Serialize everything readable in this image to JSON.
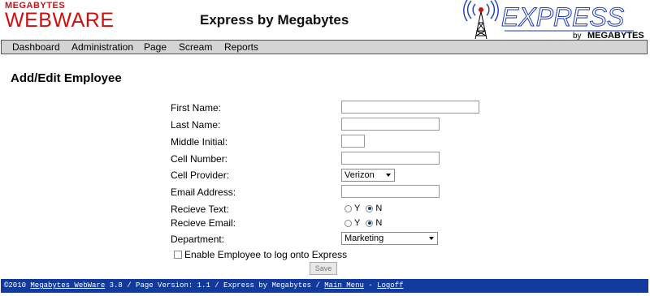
{
  "header": {
    "logo_top": "MEGABYTES",
    "logo_main": "WEBWARE",
    "title": "Express by Megabytes",
    "brand_word": "EXPRESS",
    "brand_by": "by",
    "brand_company": "MEGABYTES"
  },
  "nav": [
    "Dashboard",
    "Administration",
    "Page",
    "Scream",
    "Reports"
  ],
  "page_title": "Add/Edit Employee",
  "form": {
    "first_name_label": "First Name:",
    "first_name_value": "",
    "last_name_label": "Last Name:",
    "last_name_value": "",
    "middle_initial_label": "Middle Initial:",
    "middle_initial_value": "",
    "cell_number_label": "Cell Number:",
    "cell_number_value": "",
    "cell_provider_label": "Cell Provider:",
    "cell_provider_value": "Verizon",
    "email_label": "Email Address:",
    "email_value": "",
    "receive_text_label": "Recieve Text:",
    "receive_email_label": "Recieve Email:",
    "yes_label": "Y",
    "no_label": "N",
    "receive_text_selected": "N",
    "receive_email_selected": "N",
    "department_label": "Department:",
    "department_value": "Marketing",
    "enable_login_label": "Enable Employee to log onto Express",
    "enable_login_checked": false,
    "save_label": "Save"
  },
  "footer": {
    "prefix": "©2010 ",
    "webware_link": "Megabytes WebWare",
    "middle": " 3.8 / Page Version: 1.1 / Express by Megabytes / ",
    "main_menu_link": "Main Menu",
    "separator": " - ",
    "logoff_link": "Logoff"
  },
  "colors": {
    "logo_red": "#cc1111",
    "brand_blue": "#1a3ab8",
    "footer_bg": "#123a9c",
    "nav_bg": "#d4d4d4"
  }
}
